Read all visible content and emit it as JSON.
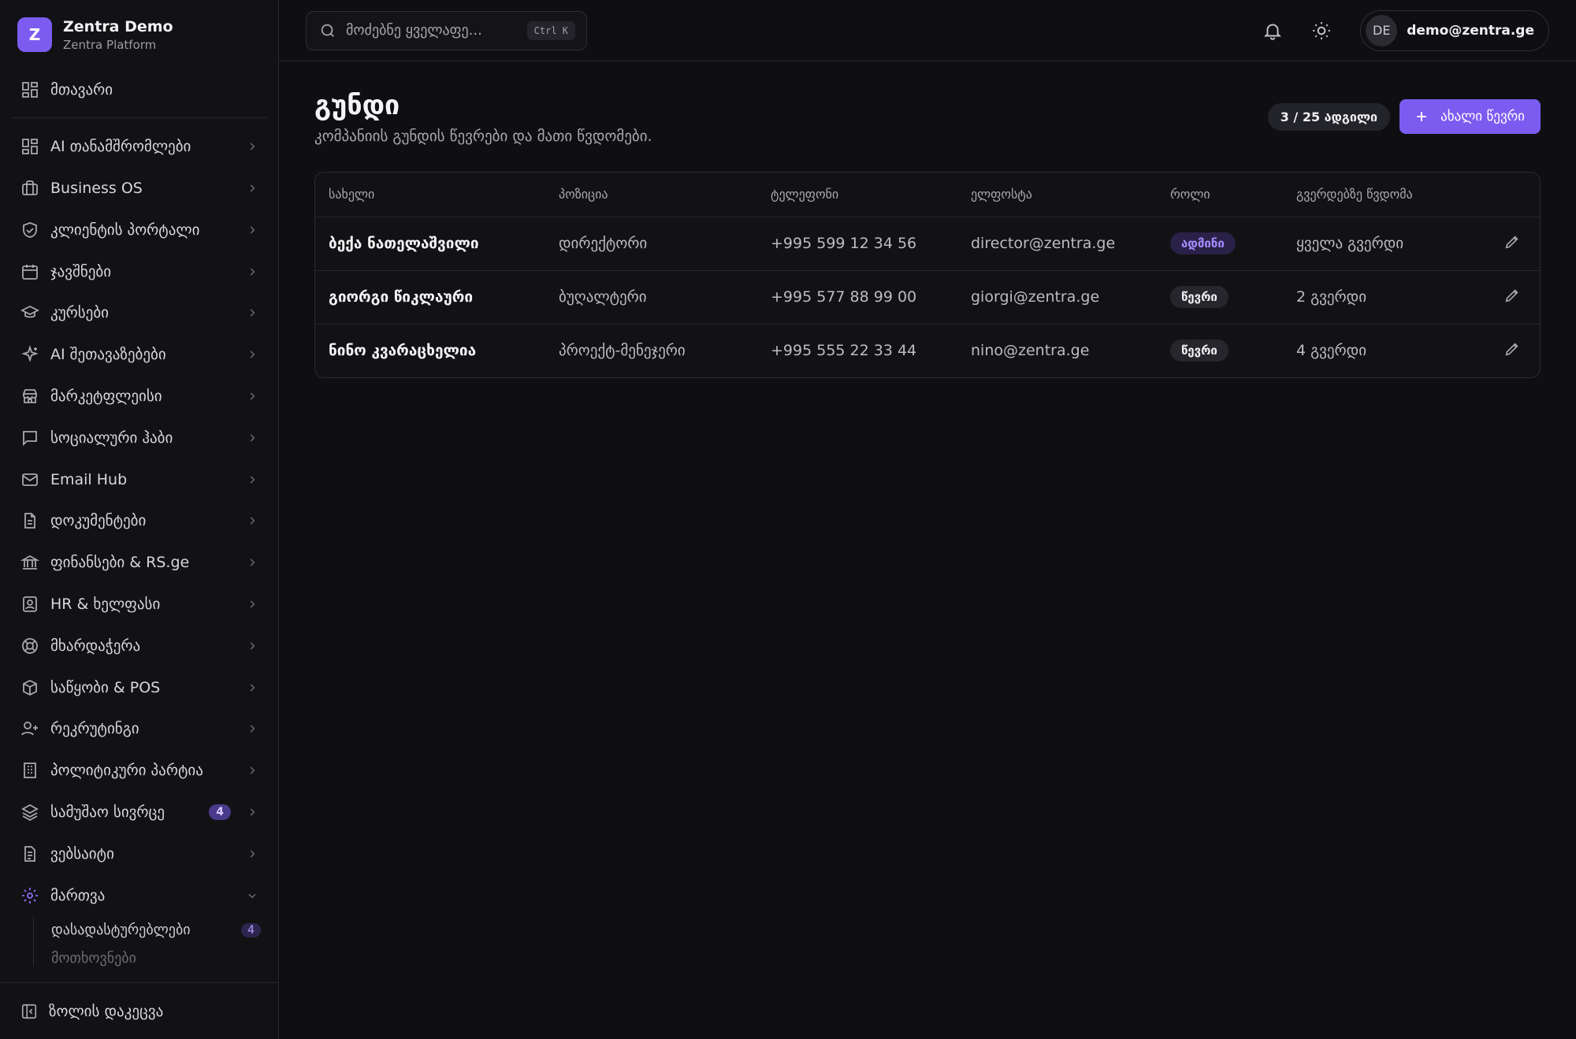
{
  "brand": {
    "logo_letter": "Z",
    "name": "Zentra Demo",
    "subtitle": "Zentra Platform"
  },
  "sidebar": {
    "home": {
      "label": "მთავარი",
      "icon": "dashboard-icon"
    },
    "items": [
      {
        "label": "AI თანამშრომლები",
        "icon": "grid-icon"
      },
      {
        "label": "Business OS",
        "icon": "briefcase-icon"
      },
      {
        "label": "კლიენტის პორტალი",
        "icon": "shield-icon"
      },
      {
        "label": "ჯავშნები",
        "icon": "calendar-icon"
      },
      {
        "label": "კურსები",
        "icon": "graduation-cap-icon"
      },
      {
        "label": "AI შეთავაზებები",
        "icon": "sparkles-icon"
      },
      {
        "label": "მარკეტფლეისი",
        "icon": "store-icon"
      },
      {
        "label": "სოციალური ჰაბი",
        "icon": "message-icon"
      },
      {
        "label": "Email Hub",
        "icon": "mail-icon"
      },
      {
        "label": "დოკუმენტები",
        "icon": "document-icon"
      },
      {
        "label": "ფინანსები & RS.ge",
        "icon": "bank-icon"
      },
      {
        "label": "HR & ხელფასი",
        "icon": "id-card-icon"
      },
      {
        "label": "მხარდაჭერა",
        "icon": "lifebuoy-icon"
      },
      {
        "label": "საწყობი & POS",
        "icon": "box-icon"
      },
      {
        "label": "რეკრუტინგი",
        "icon": "user-plus-icon"
      },
      {
        "label": "პოლიტიკური პარტია",
        "icon": "building-icon"
      },
      {
        "label": "სამუშაო სივრცე",
        "icon": "layers-icon",
        "badge": "4"
      },
      {
        "label": "ვებსაიტი",
        "icon": "file-icon"
      }
    ],
    "admin": {
      "label": "მართვა",
      "icon": "gear-icon"
    },
    "sub_items": [
      {
        "label": "დასადასტურებლები",
        "badge": "4"
      },
      {
        "label": "მოთხოვნები"
      }
    ],
    "collapse_label": "ზოლის დაკეცვა"
  },
  "topbar": {
    "search_placeholder": "მოძებნე ყველაფე...",
    "shortcut": "Ctrl K",
    "user_initials": "DE",
    "user_email": "demo@zentra.ge"
  },
  "page": {
    "title": "გუნდი",
    "subtitle": "კომპანიის გუნდის წევრები და მათი წვდომები.",
    "seats": "3 / 25 ადგილი",
    "add_button": "ახალი წევრი"
  },
  "table": {
    "headers": [
      "სახელი",
      "პოზიცია",
      "ტელეფონი",
      "ელფოსტა",
      "როლი",
      "გვერდებზე წვდომა"
    ],
    "rows": [
      {
        "name": "ბექა ნათელაშვილი",
        "position": "დირექტორი",
        "phone": "+995 599 12 34 56",
        "email": "director@zentra.ge",
        "role": "ადმინი",
        "access": "ყველა გვერდი"
      },
      {
        "name": "გიორგი წიკლაური",
        "position": "ბუღალტერი",
        "phone": "+995 577 88 99 00",
        "email": "giorgi@zentra.ge",
        "role": "წევრი",
        "access": "2 გვერდი"
      },
      {
        "name": "ნინო კვარაცხელია",
        "position": "პროექტ-მენეჯერი",
        "phone": "+995 555 22 33 44",
        "email": "nino@zentra.ge",
        "role": "წევრი",
        "access": "4 გვერდი"
      }
    ]
  },
  "colors": {
    "accent": "#7c5cf0",
    "background": "#0f0f12",
    "sidebar": "#121215"
  }
}
